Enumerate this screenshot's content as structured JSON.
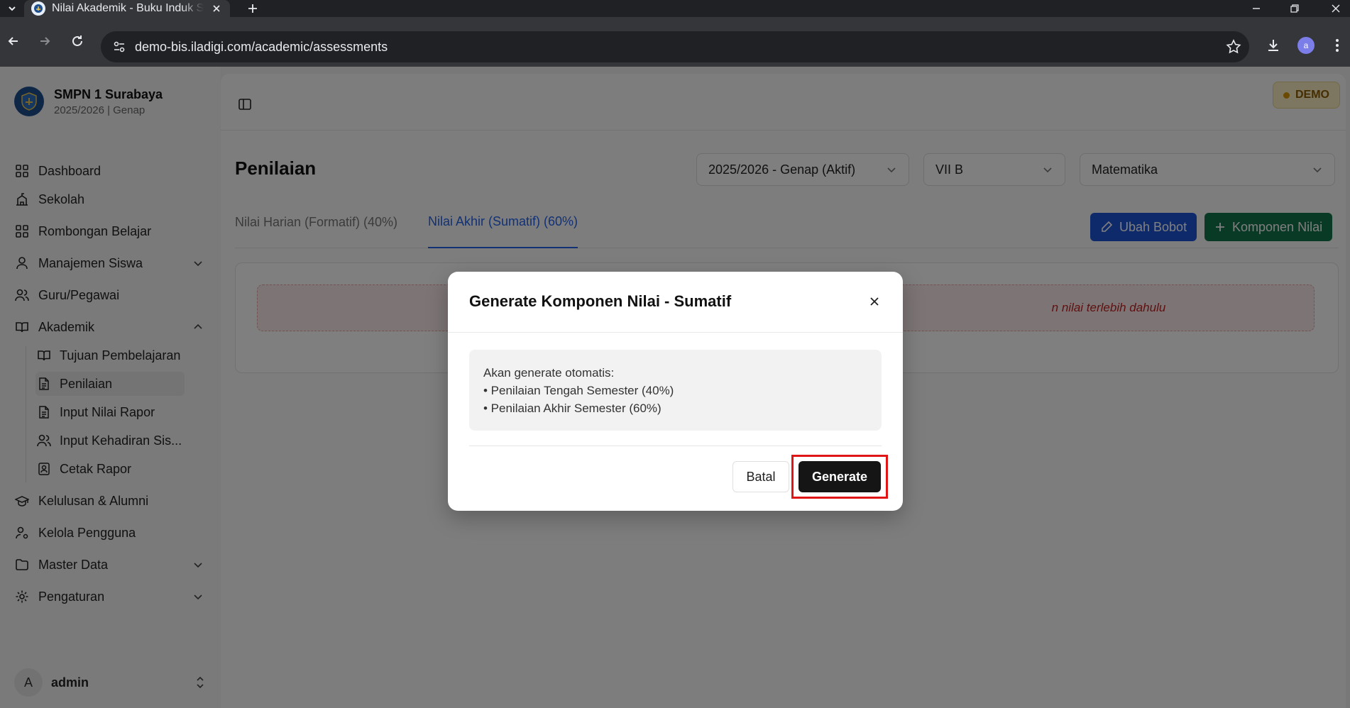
{
  "browser": {
    "tab_title": "Nilai Akademik - Buku Induk Siswa",
    "url": "demo-bis.iladigi.com/academic/assessments",
    "profile_initial": "a"
  },
  "sidebar": {
    "school_name": "SMPN 1 Surabaya",
    "school_period": "2025/2026 | Genap",
    "items": [
      {
        "label": "Dashboard",
        "icon": "grid-icon"
      },
      {
        "label": "Sekolah",
        "icon": "school-icon"
      },
      {
        "label": "Rombongan Belajar",
        "icon": "grid-icon"
      },
      {
        "label": "Manajemen Siswa",
        "icon": "user-icon"
      },
      {
        "label": "Guru/Pegawai",
        "icon": "users-icon"
      },
      {
        "label": "Akademik",
        "icon": "book-icon"
      },
      {
        "label": "Kelulusan & Alumni",
        "icon": "graduation-cap-icon"
      },
      {
        "label": "Kelola Pengguna",
        "icon": "user-cog-icon"
      },
      {
        "label": "Master Data",
        "icon": "folder-icon"
      },
      {
        "label": "Pengaturan",
        "icon": "gear-icon"
      }
    ],
    "sub_items": [
      {
        "label": "Tujuan Pembelajaran",
        "icon": "book-open-icon"
      },
      {
        "label": "Penilaian",
        "icon": "file-text-icon"
      },
      {
        "label": "Input Nilai Rapor",
        "icon": "file-text-icon"
      },
      {
        "label": "Input Kehadiran Sis...",
        "icon": "users-icon"
      },
      {
        "label": "Cetak Rapor",
        "icon": "file-badge-icon"
      }
    ],
    "user_initial": "A",
    "user_name": "admin"
  },
  "header": {
    "demo_badge": "DEMO"
  },
  "page": {
    "title": "Penilaian",
    "filters": {
      "period": "2025/2026 - Genap (Aktif)",
      "class": "VII B",
      "subject": "Matematika"
    },
    "tabs": [
      {
        "label": "Nilai Harian (Formatif) (40%)",
        "active": false
      },
      {
        "label": "Nilai Akhir (Sumatif) (60%)",
        "active": true
      }
    ],
    "buttons": {
      "edit_weight": "Ubah Bobot",
      "add_component": "Komponen Nilai"
    },
    "alert_text": "n nilai terlebih dahulu"
  },
  "dialog": {
    "title": "Generate Komponen Nilai - Sumatif",
    "intro": "Akan generate otomatis:",
    "lines": [
      "• Penilaian Tengah Semester (40%)",
      "• Penilaian Akhir Semester (60%)"
    ],
    "cancel_label": "Batal",
    "generate_label": "Generate"
  },
  "colors": {
    "primary_blue": "#1f55d6",
    "success_green": "#11744a",
    "dialog_primary": "#151515",
    "highlight_red": "#e01515"
  }
}
